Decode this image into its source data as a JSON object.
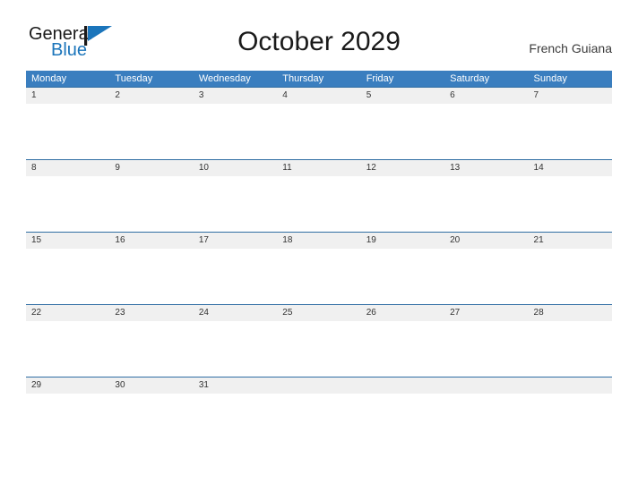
{
  "brand": {
    "name_part1": "General",
    "name_part2": "Blue",
    "flag_icon": "flag-icon",
    "color_primary": "#1b75bb",
    "color_text": "#1a1a1a"
  },
  "header": {
    "title": "October 2029",
    "region": "French Guiana"
  },
  "calendar": {
    "header_bg": "#3a7ebf",
    "band_bg": "#f0f0f0",
    "rule_color": "#2f6da3",
    "weekdays": [
      "Monday",
      "Tuesday",
      "Wednesday",
      "Thursday",
      "Friday",
      "Saturday",
      "Sunday"
    ],
    "weeks": [
      {
        "days": [
          "1",
          "2",
          "3",
          "4",
          "5",
          "6",
          "7"
        ]
      },
      {
        "days": [
          "8",
          "9",
          "10",
          "11",
          "12",
          "13",
          "14"
        ]
      },
      {
        "days": [
          "15",
          "16",
          "17",
          "18",
          "19",
          "20",
          "21"
        ]
      },
      {
        "days": [
          "22",
          "23",
          "24",
          "25",
          "26",
          "27",
          "28"
        ]
      },
      {
        "days": [
          "29",
          "30",
          "31",
          "",
          "",
          "",
          ""
        ]
      }
    ]
  }
}
